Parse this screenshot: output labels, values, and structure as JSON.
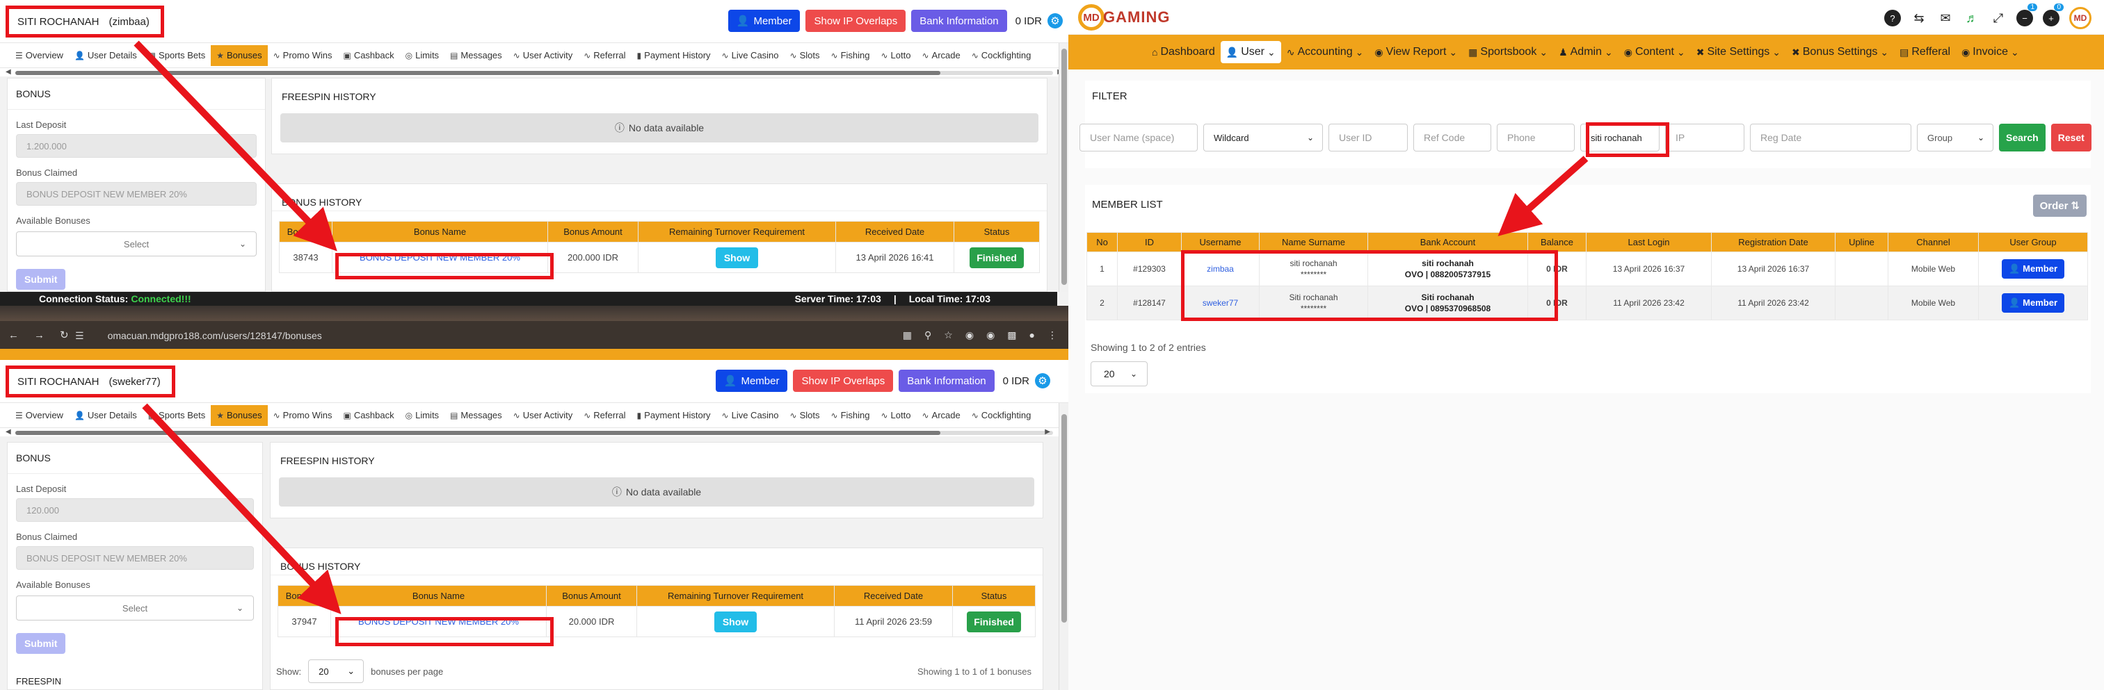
{
  "left_top": {
    "user_name": "SITI ROCHANAH",
    "username": "(zimbaa)",
    "buttons": {
      "member": "Member",
      "ip": "Show IP Overlaps",
      "bank": "Bank Information",
      "balance": "0 IDR"
    },
    "tabs": [
      "Overview",
      "User Details",
      "Sports Bets",
      "Bonuses",
      "Promo Wins",
      "Cashback",
      "Limits",
      "Messages",
      "User Activity",
      "Referral",
      "Payment History",
      "Live Casino",
      "Slots",
      "Fishing",
      "Lotto",
      "Arcade",
      "Cockfighting"
    ],
    "bonus": {
      "title": "BONUS",
      "last_deposit_label": "Last Deposit",
      "last_deposit_value": "1.200.000",
      "claimed_label": "Bonus Claimed",
      "claimed_value": "BONUS DEPOSIT NEW MEMBER 20%",
      "available_label": "Available Bonuses",
      "select": "Select",
      "submit": "Submit"
    },
    "freespin": {
      "title": "FREESPIN HISTORY",
      "nodata": "No data available"
    },
    "history": {
      "title": "BONUS HISTORY",
      "headers": [
        "Bonus ID",
        "Bonus Name",
        "Bonus Amount",
        "Remaining Turnover Requirement",
        "Received Date",
        "Status"
      ],
      "row": {
        "id": "38743",
        "name": "BONUS DEPOSIT NEW MEMBER 20%",
        "amount": "200.000 IDR",
        "turnover": "Show",
        "date": "13 April 2026 16:41",
        "status": "Finished"
      }
    },
    "status_bar": {
      "label": "Connection Status:",
      "value": "Connected!!!",
      "server": "Server Time: 17:03",
      "local": "Local Time: 17:03"
    }
  },
  "browser": {
    "url": "omacuan.mdgpro188.com/users/128147/bonuses"
  },
  "left_bottom": {
    "user_name": "SITI ROCHANAH",
    "username": "(sweker77)",
    "buttons": {
      "member": "Member",
      "ip": "Show IP Overlaps",
      "bank": "Bank Information",
      "balance": "0 IDR"
    },
    "tabs": [
      "Overview",
      "User Details",
      "Sports Bets",
      "Bonuses",
      "Promo Wins",
      "Cashback",
      "Limits",
      "Messages",
      "User Activity",
      "Referral",
      "Payment History",
      "Live Casino",
      "Slots",
      "Fishing",
      "Lotto",
      "Arcade",
      "Cockfighting"
    ],
    "bonus": {
      "title": "BONUS",
      "last_deposit_label": "Last Deposit",
      "last_deposit_value": "120.000",
      "claimed_label": "Bonus Claimed",
      "claimed_value": "BONUS DEPOSIT NEW MEMBER 20%",
      "available_label": "Available Bonuses",
      "select": "Select",
      "submit": "Submit",
      "next_title": "FREESPIN"
    },
    "freespin": {
      "title": "FREESPIN HISTORY",
      "nodata": "No data available"
    },
    "history": {
      "title": "BONUS HISTORY",
      "headers": [
        "Bonus ID",
        "Bonus Name",
        "Bonus Amount",
        "Remaining Turnover Requirement",
        "Received Date",
        "Status"
      ],
      "row": {
        "id": "37947",
        "name": "BONUS DEPOSIT NEW MEMBER 20%",
        "amount": "20.000 IDR",
        "turnover": "Show",
        "date": "11 April 2026 23:59",
        "status": "Finished"
      },
      "show_label": "Show:",
      "per_page": "20",
      "per_page_suffix": "bonuses per page",
      "showing": "Showing 1 to 1 of 1 bonuses"
    }
  },
  "right": {
    "logo": {
      "mark": "MD",
      "word": "GAMING"
    },
    "badges": {
      "notif1": "1",
      "notif2": "0"
    },
    "nav": [
      "Dashboard",
      "User",
      "Accounting",
      "View Report",
      "Sportsbook",
      "Admin",
      "Content",
      "Site Settings",
      "Bonus Settings",
      "Refferal",
      "Invoice"
    ],
    "filter": {
      "title": "FILTER",
      "username_ph": "User Name (space)",
      "match": "Wildcard",
      "userid_ph": "User ID",
      "refcode_ph": "Ref Code",
      "phone_ph": "Phone",
      "name_value": "siti rochanah",
      "ip_ph": "IP",
      "regdate_ph": "Reg Date",
      "group": "Group",
      "search": "Search",
      "reset": "Reset"
    },
    "member_list": {
      "title": "MEMBER LIST",
      "order": "Order",
      "headers": [
        "No",
        "ID",
        "Username",
        "Name Surname",
        "Bank Account",
        "Balance",
        "Last Login",
        "Registration Date",
        "Upline",
        "Channel",
        "User Group"
      ],
      "rows": [
        {
          "no": "1",
          "id": "#129303",
          "username": "zimbaa",
          "name": "siti rochanah",
          "name_mask": "********",
          "bank_name": "siti rochanah",
          "bank_acc": "OVO | 0882005737915",
          "balance": "0 IDR",
          "last_login": "13 April 2026 16:37",
          "reg_date": "13 April 2026 16:37",
          "upline": "",
          "channel": "Mobile Web",
          "group": "Member"
        },
        {
          "no": "2",
          "id": "#128147",
          "username": "sweker77",
          "name": "Siti rochanah",
          "name_mask": "********",
          "bank_name": "Siti rochanah",
          "bank_acc": "OVO | 0895370968508",
          "balance": "0 IDR",
          "last_login": "11 April 2026 23:42",
          "reg_date": "11 April 2026 23:42",
          "upline": "",
          "channel": "Mobile Web",
          "group": "Member"
        }
      ],
      "showing": "Showing 1 to 2 of 2 entries",
      "per_page": "20"
    }
  },
  "colors": {
    "accent": "#f0a31a",
    "highlight": "#e8141b",
    "member_blue": "#0d47e8",
    "ip_red": "#ee4b4b",
    "bank_purple": "#6a5ce6",
    "success": "#29a04a",
    "show_cyan": "#22bde8"
  },
  "icons": [
    "user-icon",
    "gear-icon",
    "info-icon",
    "chevron-down-icon",
    "house-icon",
    "help-icon",
    "translate-icon",
    "chat-icon",
    "sound-icon",
    "expand-icon",
    "minus-icon",
    "plus-icon",
    "sort-icon"
  ]
}
